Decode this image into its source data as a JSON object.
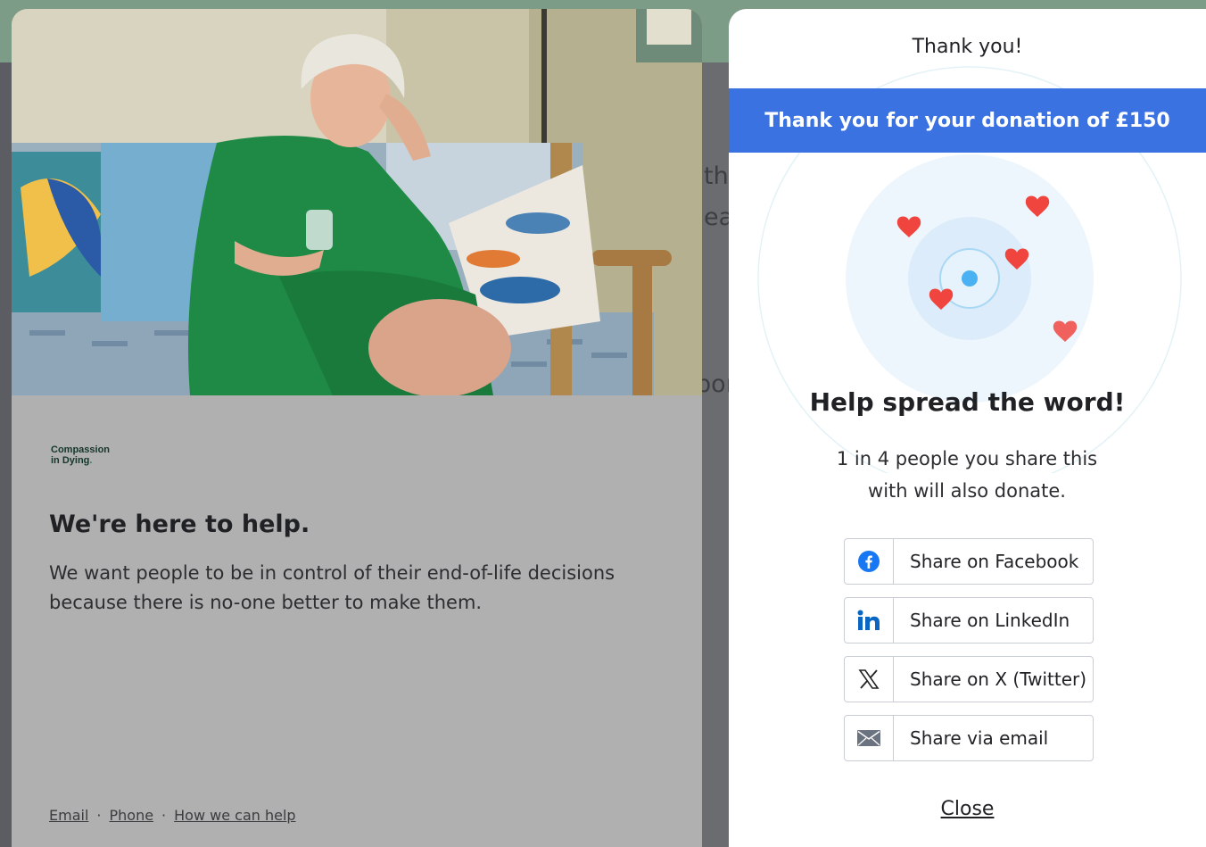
{
  "background": {
    "snippet_lines": [
      "th",
      "ea",
      "por"
    ]
  },
  "left_card": {
    "logo": {
      "line1": "Compassion",
      "line2_prefix": "in ",
      "line2_word": "Dying",
      "line2_dot": "."
    },
    "heading": "We're here to help.",
    "body": "We want people to be in control of their end-of-life decisions because there is no-one better to make them.",
    "footer_links": [
      "Email",
      "Phone",
      "How we can help"
    ],
    "footer_separator": "·"
  },
  "panel": {
    "title": "Thank you!",
    "banner": "Thank you for your donation of £150",
    "help_title": "Help spread the word!",
    "help_subtitle": "1 in 4 people you share this with will also donate.",
    "share_buttons": [
      {
        "label": "Share on Facebook",
        "icon": "facebook-icon"
      },
      {
        "label": "Share on LinkedIn",
        "icon": "linkedin-icon"
      },
      {
        "label": "Share on X (Twitter)",
        "icon": "x-twitter-icon"
      },
      {
        "label": "Share via email",
        "icon": "email-icon"
      }
    ],
    "close_label": "Close"
  },
  "colors": {
    "banner": "#3b72e2",
    "heart": "#f0453f",
    "facebook": "#1877f2",
    "linkedin": "#0a66c2",
    "overlay": "#b0b0b0"
  }
}
